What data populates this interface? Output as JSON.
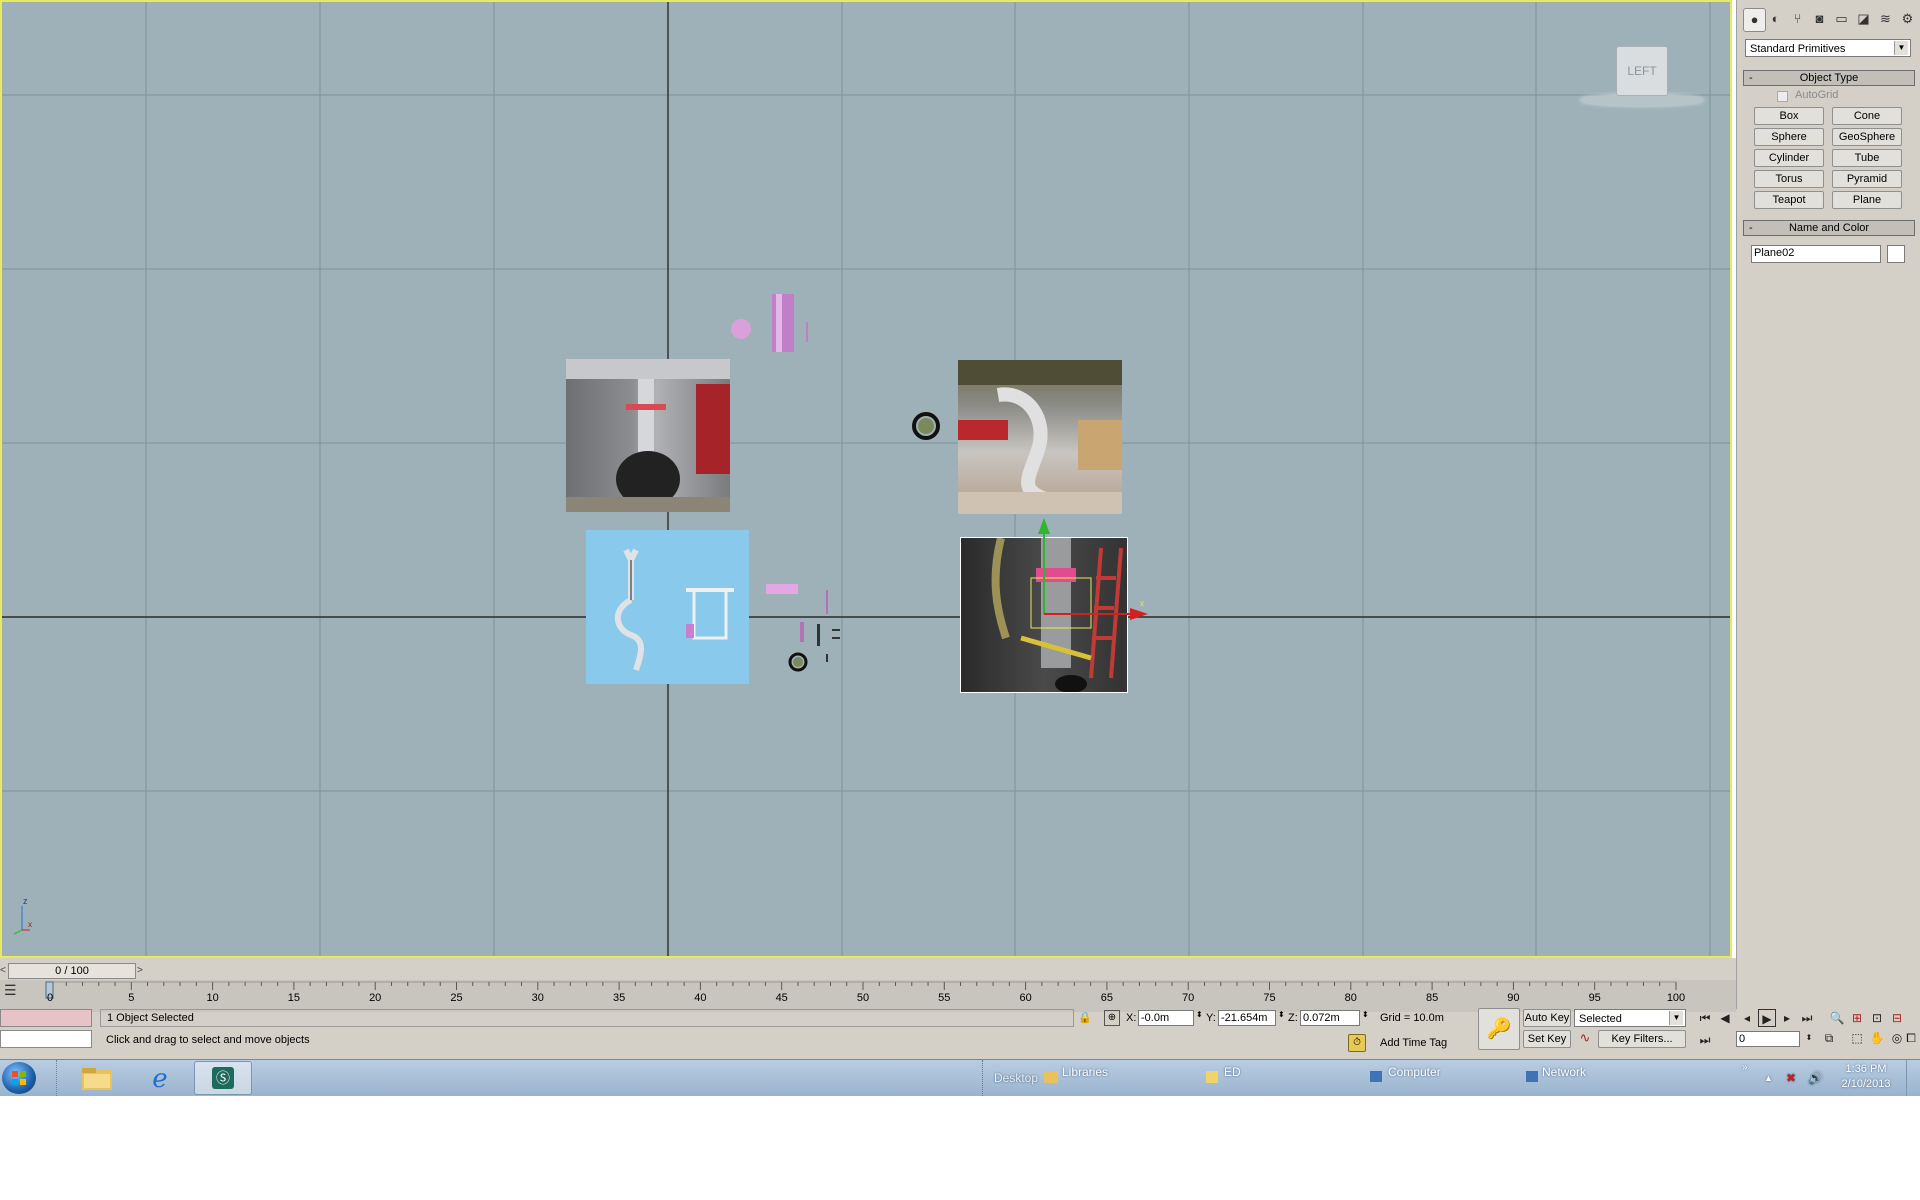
{
  "viewport": {
    "label": "LEFT",
    "axis_z": "z",
    "axis_x": "x"
  },
  "command_panel": {
    "tab_icons": [
      "create-icon",
      "modify-icon",
      "hierarchy-icon",
      "motion-icon",
      "display-icon",
      "utilities-icon",
      "spacewarps-icon",
      "systems-icon"
    ],
    "category": "Standard Primitives",
    "object_type": {
      "title": "Object Type",
      "autogrid_label": "AutoGrid",
      "buttons": [
        "Box",
        "Cone",
        "Sphere",
        "GeoSphere",
        "Cylinder",
        "Tube",
        "Torus",
        "Pyramid",
        "Teapot",
        "Plane"
      ]
    },
    "name_and_color": {
      "title": "Name and Color",
      "name_value": "Plane02",
      "color": "#ffffff"
    },
    "rollout_minus": "-"
  },
  "timeline": {
    "frame_display": "0 / 100",
    "ticks": [
      "0",
      "5",
      "10",
      "15",
      "20",
      "25",
      "30",
      "35",
      "40",
      "45",
      "50",
      "55",
      "60",
      "65",
      "70",
      "75",
      "80",
      "85",
      "90",
      "95",
      "100"
    ]
  },
  "status": {
    "selection": "1 Object Selected",
    "prompt": "Click and drag to select and move objects",
    "x_label": "X:",
    "x_value": "-0.0m",
    "y_label": "Y:",
    "y_value": "-21.654m",
    "z_label": "Z:",
    "z_value": "0.072m",
    "grid": "Grid = 10.0m",
    "add_time_tag": "Add Time Tag",
    "auto_key": "Auto Key",
    "set_key": "Set Key",
    "key_mode": "Selected",
    "key_filters": "Key Filters...",
    "current_frame": "0"
  },
  "taskbar": {
    "items": [
      "Desktop",
      "Libraries",
      "ED",
      "Computer",
      "Network"
    ],
    "time": "1:36 PM",
    "date": "2/10/2013"
  },
  "colors": {
    "viewport_bg": "#9eb1b8",
    "viewport_border": "#e9ea5a",
    "panel_bg": "#d4d0c8",
    "primitive_pink": "#d79ad6"
  }
}
